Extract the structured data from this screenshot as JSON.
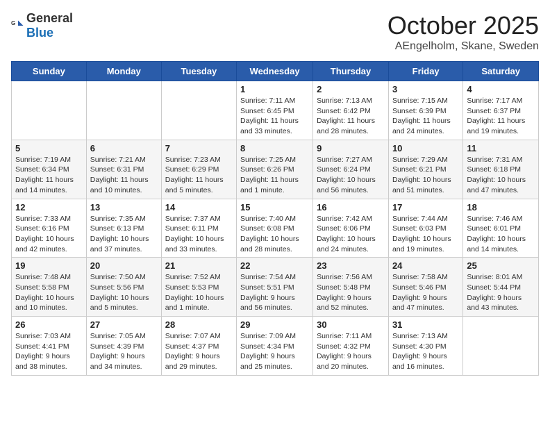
{
  "header": {
    "logo_general": "General",
    "logo_blue": "Blue",
    "month": "October 2025",
    "location": "AEngelholm, Skane, Sweden"
  },
  "days_of_week": [
    "Sunday",
    "Monday",
    "Tuesday",
    "Wednesday",
    "Thursday",
    "Friday",
    "Saturday"
  ],
  "weeks": [
    [
      {
        "day": "",
        "info": ""
      },
      {
        "day": "",
        "info": ""
      },
      {
        "day": "",
        "info": ""
      },
      {
        "day": "1",
        "info": "Sunrise: 7:11 AM\nSunset: 6:45 PM\nDaylight: 11 hours\nand 33 minutes."
      },
      {
        "day": "2",
        "info": "Sunrise: 7:13 AM\nSunset: 6:42 PM\nDaylight: 11 hours\nand 28 minutes."
      },
      {
        "day": "3",
        "info": "Sunrise: 7:15 AM\nSunset: 6:39 PM\nDaylight: 11 hours\nand 24 minutes."
      },
      {
        "day": "4",
        "info": "Sunrise: 7:17 AM\nSunset: 6:37 PM\nDaylight: 11 hours\nand 19 minutes."
      }
    ],
    [
      {
        "day": "5",
        "info": "Sunrise: 7:19 AM\nSunset: 6:34 PM\nDaylight: 11 hours\nand 14 minutes."
      },
      {
        "day": "6",
        "info": "Sunrise: 7:21 AM\nSunset: 6:31 PM\nDaylight: 11 hours\nand 10 minutes."
      },
      {
        "day": "7",
        "info": "Sunrise: 7:23 AM\nSunset: 6:29 PM\nDaylight: 11 hours\nand 5 minutes."
      },
      {
        "day": "8",
        "info": "Sunrise: 7:25 AM\nSunset: 6:26 PM\nDaylight: 11 hours\nand 1 minute."
      },
      {
        "day": "9",
        "info": "Sunrise: 7:27 AM\nSunset: 6:24 PM\nDaylight: 10 hours\nand 56 minutes."
      },
      {
        "day": "10",
        "info": "Sunrise: 7:29 AM\nSunset: 6:21 PM\nDaylight: 10 hours\nand 51 minutes."
      },
      {
        "day": "11",
        "info": "Sunrise: 7:31 AM\nSunset: 6:18 PM\nDaylight: 10 hours\nand 47 minutes."
      }
    ],
    [
      {
        "day": "12",
        "info": "Sunrise: 7:33 AM\nSunset: 6:16 PM\nDaylight: 10 hours\nand 42 minutes."
      },
      {
        "day": "13",
        "info": "Sunrise: 7:35 AM\nSunset: 6:13 PM\nDaylight: 10 hours\nand 37 minutes."
      },
      {
        "day": "14",
        "info": "Sunrise: 7:37 AM\nSunset: 6:11 PM\nDaylight: 10 hours\nand 33 minutes."
      },
      {
        "day": "15",
        "info": "Sunrise: 7:40 AM\nSunset: 6:08 PM\nDaylight: 10 hours\nand 28 minutes."
      },
      {
        "day": "16",
        "info": "Sunrise: 7:42 AM\nSunset: 6:06 PM\nDaylight: 10 hours\nand 24 minutes."
      },
      {
        "day": "17",
        "info": "Sunrise: 7:44 AM\nSunset: 6:03 PM\nDaylight: 10 hours\nand 19 minutes."
      },
      {
        "day": "18",
        "info": "Sunrise: 7:46 AM\nSunset: 6:01 PM\nDaylight: 10 hours\nand 14 minutes."
      }
    ],
    [
      {
        "day": "19",
        "info": "Sunrise: 7:48 AM\nSunset: 5:58 PM\nDaylight: 10 hours\nand 10 minutes."
      },
      {
        "day": "20",
        "info": "Sunrise: 7:50 AM\nSunset: 5:56 PM\nDaylight: 10 hours\nand 5 minutes."
      },
      {
        "day": "21",
        "info": "Sunrise: 7:52 AM\nSunset: 5:53 PM\nDaylight: 10 hours\nand 1 minute."
      },
      {
        "day": "22",
        "info": "Sunrise: 7:54 AM\nSunset: 5:51 PM\nDaylight: 9 hours\nand 56 minutes."
      },
      {
        "day": "23",
        "info": "Sunrise: 7:56 AM\nSunset: 5:48 PM\nDaylight: 9 hours\nand 52 minutes."
      },
      {
        "day": "24",
        "info": "Sunrise: 7:58 AM\nSunset: 5:46 PM\nDaylight: 9 hours\nand 47 minutes."
      },
      {
        "day": "25",
        "info": "Sunrise: 8:01 AM\nSunset: 5:44 PM\nDaylight: 9 hours\nand 43 minutes."
      }
    ],
    [
      {
        "day": "26",
        "info": "Sunrise: 7:03 AM\nSunset: 4:41 PM\nDaylight: 9 hours\nand 38 minutes."
      },
      {
        "day": "27",
        "info": "Sunrise: 7:05 AM\nSunset: 4:39 PM\nDaylight: 9 hours\nand 34 minutes."
      },
      {
        "day": "28",
        "info": "Sunrise: 7:07 AM\nSunset: 4:37 PM\nDaylight: 9 hours\nand 29 minutes."
      },
      {
        "day": "29",
        "info": "Sunrise: 7:09 AM\nSunset: 4:34 PM\nDaylight: 9 hours\nand 25 minutes."
      },
      {
        "day": "30",
        "info": "Sunrise: 7:11 AM\nSunset: 4:32 PM\nDaylight: 9 hours\nand 20 minutes."
      },
      {
        "day": "31",
        "info": "Sunrise: 7:13 AM\nSunset: 4:30 PM\nDaylight: 9 hours\nand 16 minutes."
      },
      {
        "day": "",
        "info": ""
      }
    ]
  ]
}
